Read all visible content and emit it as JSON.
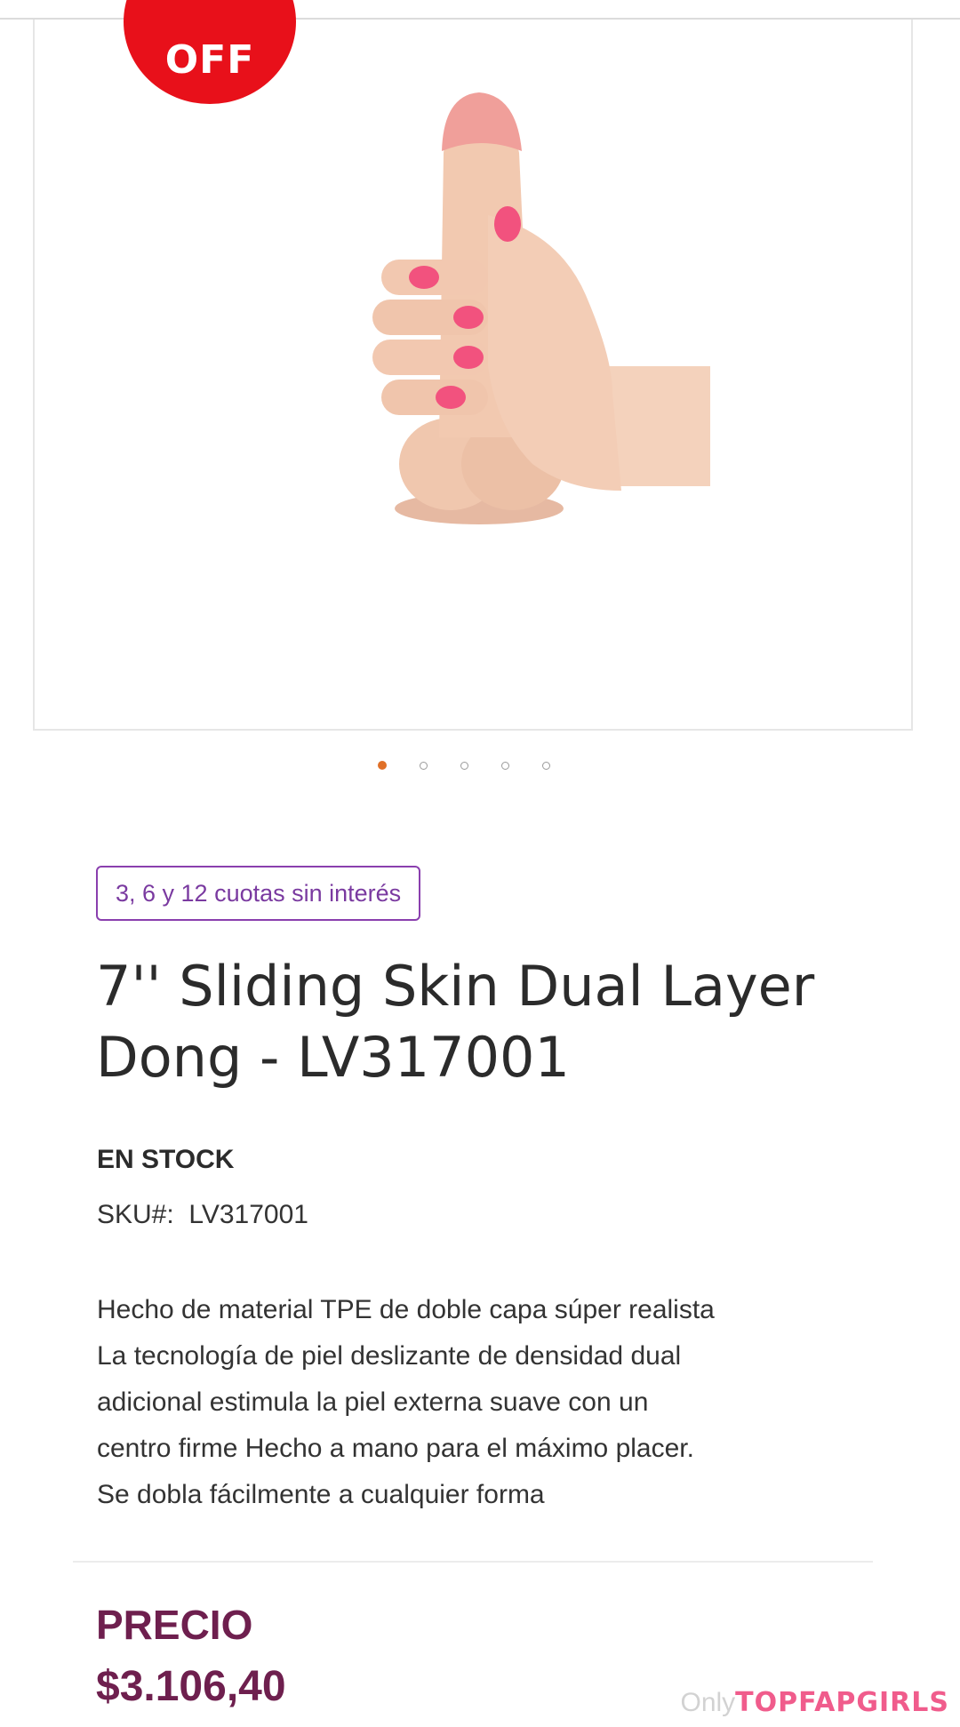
{
  "badge": {
    "discount_label": "OFF"
  },
  "gallery": {
    "image_icon": "product-photo",
    "slide_count": 5,
    "active_slide": 1
  },
  "installments": {
    "label": "3, 6 y 12 cuotas sin interés"
  },
  "product": {
    "title": "7'' Sliding Skin Dual Layer Dong - LV317001",
    "stock_status": "EN STOCK",
    "sku_label": "SKU#:",
    "sku_value": "LV317001",
    "description_lines": [
      "Hecho de material TPE de doble capa súper realista",
      "La tecnología de piel deslizante de densidad dual",
      "adicional estimula la piel externa suave con un",
      "centro firme Hecho a mano para el máximo placer.",
      "Se dobla fácilmente a cualquier forma"
    ]
  },
  "price": {
    "label": "PRECIO",
    "value": "$3.106,40"
  },
  "watermark": {
    "part_a": "Only",
    "part_b": "TOPFAPGIRLS"
  },
  "colors": {
    "badge_red": "#e8101a",
    "accent_purple": "#8a3fae",
    "price_maroon": "#6e1f4e",
    "active_dot": "#e07028"
  }
}
